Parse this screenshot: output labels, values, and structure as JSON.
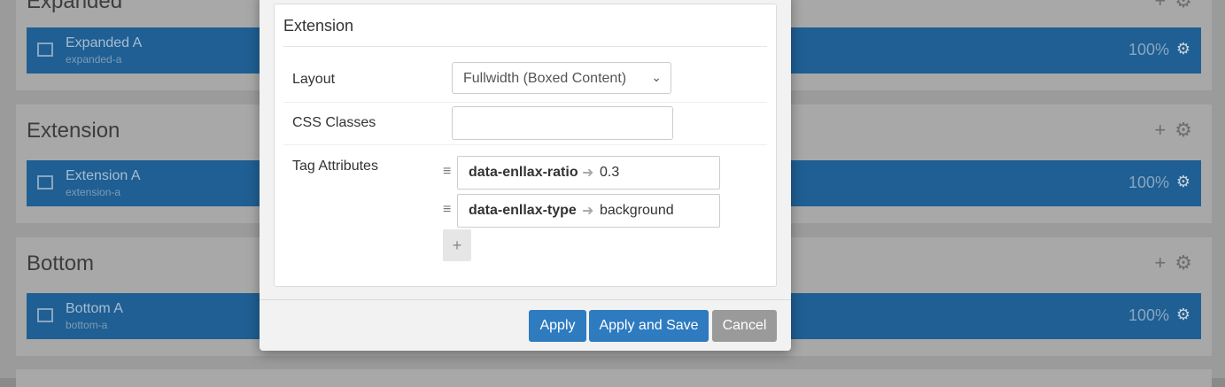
{
  "background": {
    "sections": [
      {
        "title": "Expanded",
        "block": {
          "name": "Expanded A",
          "id": "expanded-a",
          "percent": "100%"
        }
      },
      {
        "title": "Extension",
        "block": {
          "name": "Extension A",
          "id": "extension-a",
          "percent": "100%"
        }
      },
      {
        "title": "Bottom",
        "block": {
          "name": "Bottom A",
          "id": "bottom-a",
          "percent": "100%"
        }
      }
    ],
    "tools": {
      "add": "+",
      "settings": "⚙"
    }
  },
  "modal": {
    "title": "Extension",
    "layout": {
      "label": "Layout",
      "value": "Fullwidth (Boxed Content)"
    },
    "css_classes": {
      "label": "CSS Classes",
      "value": ""
    },
    "tag_attributes": {
      "label": "Tag Attributes",
      "items": [
        {
          "key": "data-enllax-ratio",
          "value": "0.3"
        },
        {
          "key": "data-enllax-type",
          "value": "background"
        }
      ],
      "add_label": "+"
    },
    "buttons": {
      "apply": "Apply",
      "apply_save": "Apply and Save",
      "cancel": "Cancel"
    }
  },
  "colors": {
    "accent": "#2e7bc0",
    "block": "#1f5f93",
    "cancel": "#9a9a9a"
  }
}
